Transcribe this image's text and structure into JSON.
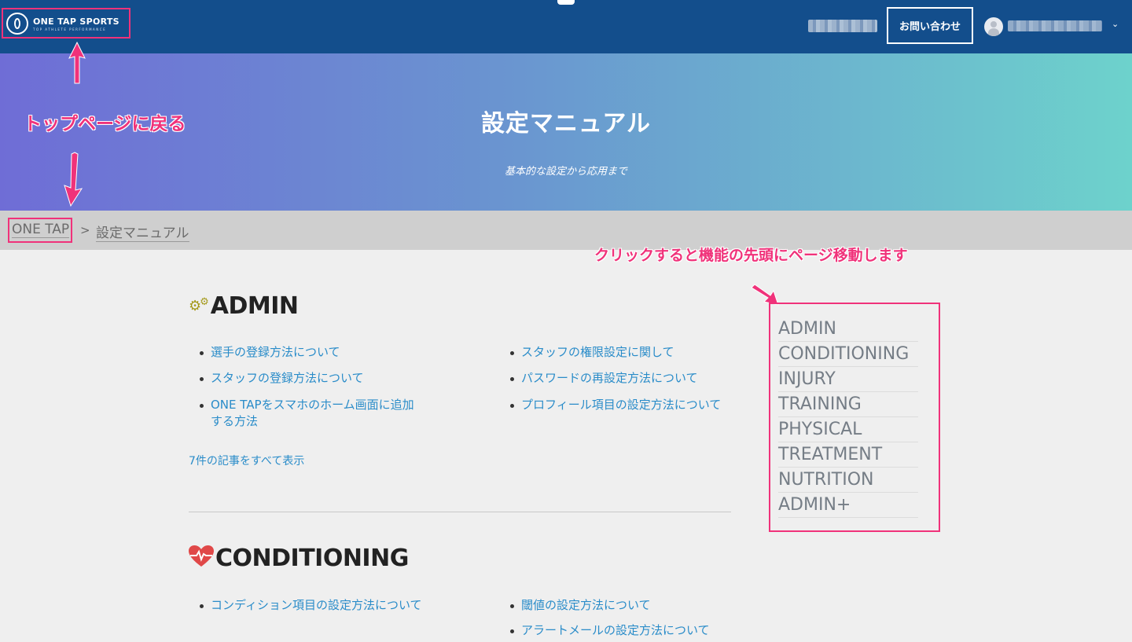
{
  "header": {
    "logo_title": "ONE TAP SPORTS",
    "logo_tagline": "TOP ATHLETE PERFORMANCE",
    "contact_label": "お問い合わせ",
    "user_menu_icon": "chevron-down-icon"
  },
  "hero": {
    "title": "設定マニュアル",
    "subtitle": "基本的な設定から応用まで"
  },
  "breadcrumb": {
    "home": "ONE TAP",
    "separator": ">",
    "current": "設定マニュアル"
  },
  "annotations": {
    "top_page": "トップページに戻る",
    "toc_hint": "クリックすると機能の先頭にページ移動します",
    "color": "#f0327a"
  },
  "sections": [
    {
      "title": "ADMIN",
      "icon": "gears-icon",
      "articles": [
        "選手の登録方法について",
        "スタッフの登録方法について",
        "ONE TAPをスマホのホーム画面に追加する方法",
        "スタッフの権限設定に関して",
        "パスワードの再設定方法について",
        "プロフィール項目の設定方法について"
      ],
      "more": "7件の記事をすべて表示"
    },
    {
      "title": "CONDITIONING",
      "icon": "heartbeat-icon",
      "articles": [
        "コンディション項目の設定方法について",
        "閾値の設定方法について",
        "アラートメールの設定方法について"
      ]
    }
  ],
  "toc": [
    "ADMIN",
    "CONDITIONING",
    "INJURY",
    "TRAINING",
    "PHYSICAL",
    "TREATMENT",
    "NUTRITION",
    "ADMIN+"
  ],
  "colors": {
    "header_bg": "#134e8c",
    "link": "#2a8cc9",
    "hero_gradient": [
      "#6f6dd6",
      "#6a95d0",
      "#6dd2cc"
    ]
  }
}
